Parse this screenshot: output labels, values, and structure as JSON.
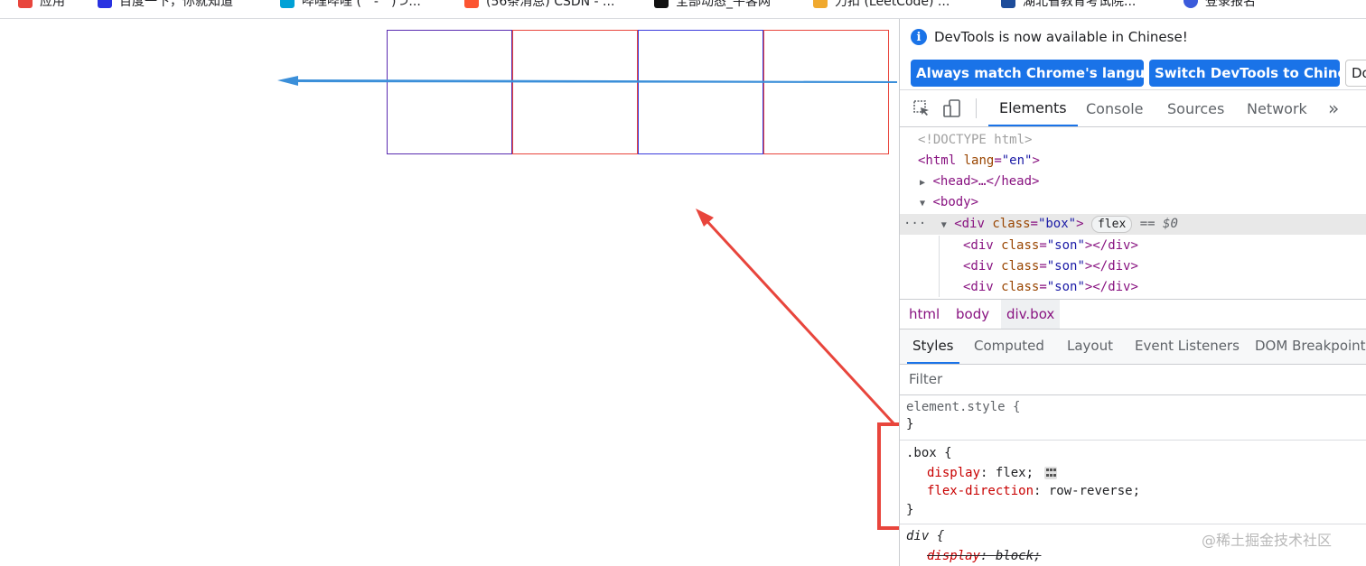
{
  "bookmarks": {
    "items": [
      {
        "label": "应用",
        "icon": "apps-icon",
        "color": "#e8453c"
      },
      {
        "label": "百度一下，你就知道",
        "icon": "baidu-icon",
        "color": "#2932e1"
      },
      {
        "label": "哔哩哔哩 (゜-゜)つ...",
        "icon": "bilibili-icon",
        "color": "#00a1d6"
      },
      {
        "label": "(56条消息) CSDN - ...",
        "icon": "csdn-icon",
        "color": "#fc5531"
      },
      {
        "label": "全部动态_牛客网",
        "icon": "nowcoder-icon",
        "color": "#111111"
      },
      {
        "label": "力扣 (LeetCode) ...",
        "icon": "leetcode-icon",
        "color": "#f0a92e"
      },
      {
        "label": "湖北省教育考试院...",
        "icon": "exam-icon",
        "color": "#1d4c9a"
      },
      {
        "label": "登录报名",
        "icon": "register-icon",
        "color": "#3b5bdb"
      }
    ]
  },
  "devtools": {
    "infobar": {
      "message": "DevTools is now available in Chinese!",
      "btn_match": "Always match Chrome's language",
      "btn_switch": "Switch DevTools to Chinese",
      "btn_dont": "Don't show again"
    },
    "tabs": {
      "elements": "Elements",
      "console": "Console",
      "sources": "Sources",
      "network": "Network",
      "more": "»"
    },
    "dom": {
      "doctype": "<!DOCTYPE html>",
      "html_open": "<html",
      "html_attr": "lang",
      "html_val": "\"en\"",
      "head": "<head>…</head>",
      "body_open": "<body>",
      "div_tag": "<div",
      "div_attr": "class",
      "div_val": "\"box\"",
      "flex_badge": "flex",
      "eq_ref": "== $0",
      "son_tag": "<div",
      "son_attr": "class",
      "son_val": "\"son\"",
      "son_close": "></div>",
      "ellipsis": "···"
    },
    "crumbs": [
      "html",
      "body",
      "div.box"
    ],
    "subtabs": [
      "Styles",
      "Computed",
      "Layout",
      "Event Listeners",
      "DOM Breakpoints"
    ],
    "filter_placeholder": "Filter",
    "styles": {
      "element_style": "element.style {",
      "close": "}",
      "box_selector": ".box {",
      "prop_display": "display",
      "val_display": "flex;",
      "prop_direction": "flex-direction",
      "val_direction": "row-reverse;",
      "div_selector": "div {",
      "prop_display2": "display",
      "val_display2": "block;"
    }
  },
  "watermark": "@稀土掘金技术社区",
  "colors": {
    "accent": "#1a73e8",
    "annotation_red": "#e8453c",
    "arrow_blue": "#3b8fd9"
  }
}
